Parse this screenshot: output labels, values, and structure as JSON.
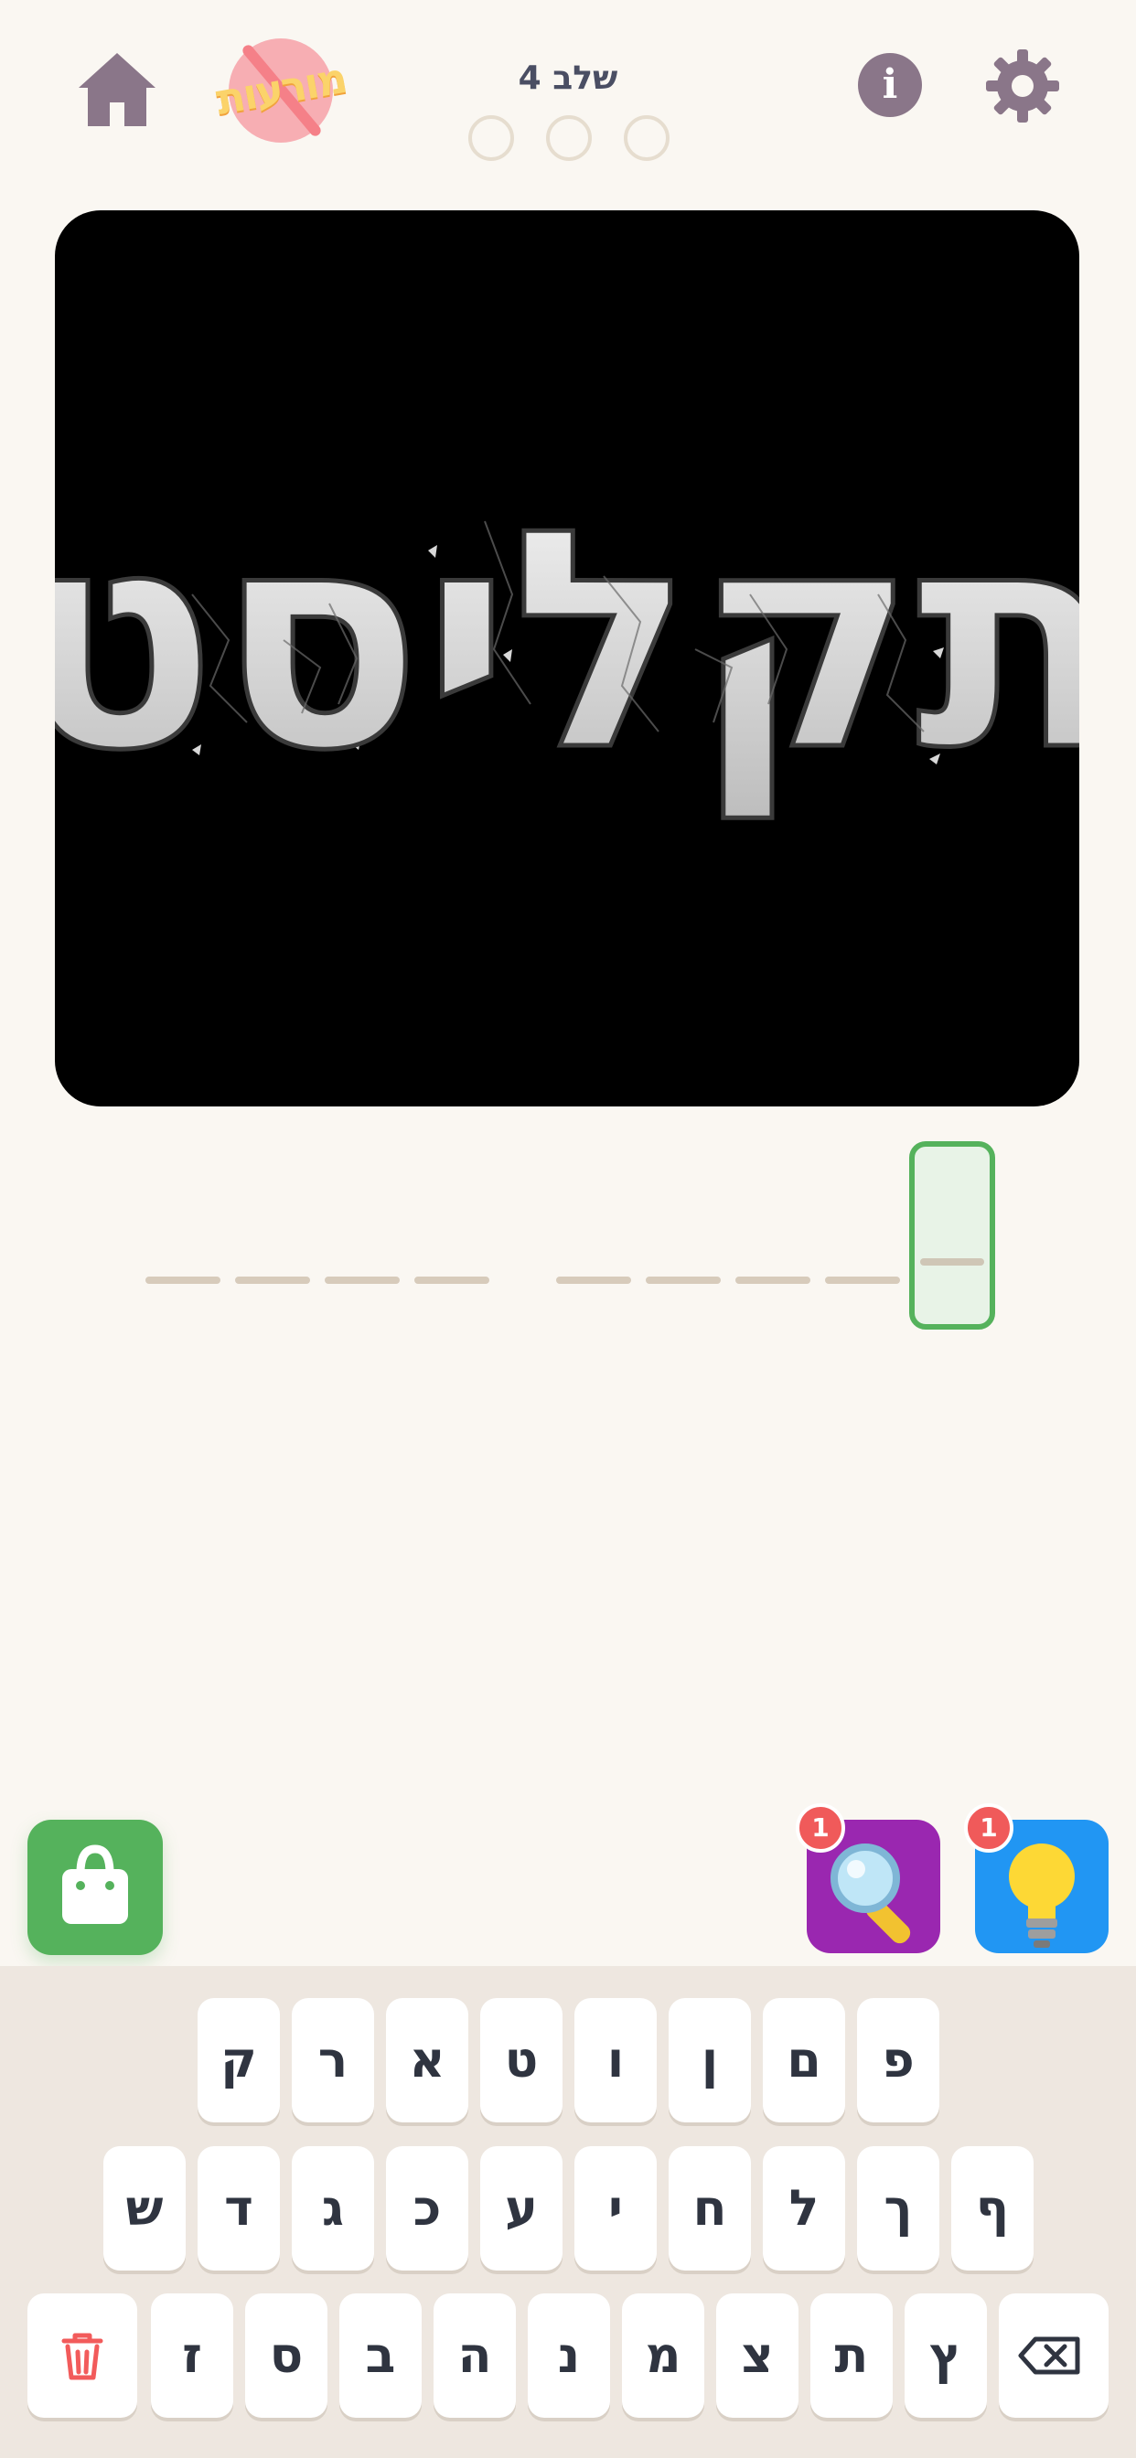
{
  "header": {
    "stage_label": "שלב 4",
    "logo_text": "מורעות",
    "info_label": "i",
    "progress": {
      "total": 3,
      "completed": 0
    }
  },
  "puzzle": {
    "image_text": "תקליסט"
  },
  "answer": {
    "word_lengths": [
      4,
      5
    ],
    "active_index": 0
  },
  "powerups": {
    "shop": {
      "icon": "shopping-bag-icon"
    },
    "magnify": {
      "icon": "magnifier-icon",
      "count": "1"
    },
    "hint": {
      "icon": "lightbulb-icon",
      "count": "1"
    }
  },
  "keyboard": {
    "row1": [
      "ק",
      "ר",
      "א",
      "ט",
      "ו",
      "ן",
      "ם",
      "פ"
    ],
    "row2": [
      "ש",
      "ד",
      "ג",
      "כ",
      "ע",
      "י",
      "ח",
      "ל",
      "ך",
      "ף"
    ],
    "row3": [
      "ז",
      "ס",
      "ב",
      "ה",
      "נ",
      "מ",
      "צ",
      "ת",
      "ץ"
    ],
    "delete_icon": "trash-icon",
    "backspace_icon": "backspace-icon"
  },
  "colors": {
    "background": "#faf7f2",
    "accent_green": "#55b25c",
    "magnify_purple": "#9a27b0",
    "hint_blue": "#2196f3",
    "badge_red": "#f05a5a",
    "icon_mauve": "#8a7689"
  }
}
